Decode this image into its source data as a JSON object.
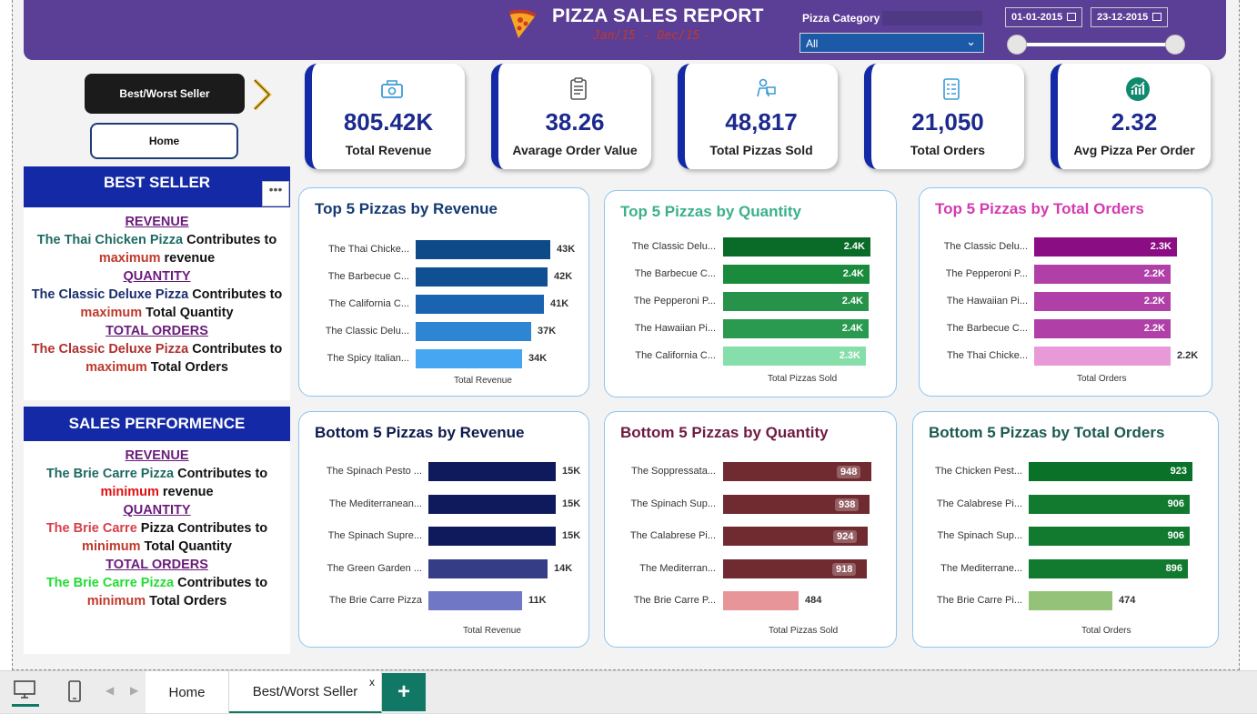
{
  "header": {
    "title": "PIZZA SALES REPORT",
    "subtitle": "Jan/15  -  Dec/15",
    "category_label": "Pizza Category",
    "category_value": "All",
    "date_start": "01-01-2015",
    "date_end": "23-12-2015"
  },
  "nav": {
    "best_worst": "Best/Worst Seller",
    "home": "Home"
  },
  "kpis": [
    {
      "value": "805.42K",
      "label": "Total Revenue",
      "icon": "money-icon"
    },
    {
      "value": "38.26",
      "label": "Avarage Order Value",
      "icon": "clipboard-icon"
    },
    {
      "value": "48,817",
      "label": "Total Pizzas Sold",
      "icon": "delivery-icon"
    },
    {
      "value": "21,050",
      "label": "Total Orders",
      "icon": "order-list-icon"
    },
    {
      "value": "2.32",
      "label": "Avg Pizza Per Order",
      "icon": "chart-icon"
    }
  ],
  "best_seller": {
    "title": "BEST SELLER",
    "revenue_h": "REVENUE",
    "revenue_name": "The Thai Chicken Pizza",
    "revenue_mid": " Contributes to",
    "revenue_kw": "maximum",
    "revenue_end": " revenue",
    "quantity_h": "QUANTITY",
    "quantity_name": "The Classic Deluxe Pizza",
    "quantity_mid": " Contributes to",
    "quantity_kw": "maximum",
    "quantity_end": " Total Quantity",
    "orders_h": "TOTAL ORDERS",
    "orders_name": "The Classic Deluxe Pizza",
    "orders_mid": " Contributes to",
    "orders_kw": "maximum",
    "orders_end": " Total Orders"
  },
  "sales_perf": {
    "title": "SALES PERFORMENCE",
    "revenue_h": "REVENUE",
    "revenue_name": "The Brie Carre Pizza",
    "revenue_mid": " Contributes to",
    "revenue_kw": "minimum",
    "revenue_end": " revenue",
    "quantity_h": "QUANTITY",
    "quantity_name": "The Brie Carre",
    "quantity_mid": " Pizza Contributes to",
    "quantity_kw": "minimum",
    "quantity_end": " Total Quantity",
    "orders_h": "TOTAL ORDERS",
    "orders_name": "The Brie Carre Pizza",
    "orders_mid": " Contributes to",
    "orders_kw": "minimum",
    "orders_end": " Total Orders"
  },
  "chart_data": [
    {
      "type": "bar",
      "title": "Top 5 Pizzas by Revenue",
      "xlabel": "Total Revenue",
      "categories": [
        "The Thai Chicke...",
        "The Barbecue C...",
        "The California C...",
        "The Classic Delu...",
        "The Spicy Italian..."
      ],
      "values": [
        43,
        42,
        41,
        37,
        34
      ],
      "labels": [
        "43K",
        "42K",
        "41K",
        "37K",
        "34K"
      ],
      "colors": [
        "#0d4a87",
        "#104f92",
        "#1a63b0",
        "#2d85d4",
        "#46a6f2"
      ],
      "label_inside": false
    },
    {
      "type": "bar",
      "title": "Top 5 Pizzas by Quantity",
      "xlabel": "Total Pizzas Sold",
      "categories": [
        "The Classic Delu...",
        "The Barbecue C...",
        "The Pepperoni P...",
        "The Hawaiian Pi...",
        "The California C..."
      ],
      "values": [
        2.45,
        2.43,
        2.42,
        2.42,
        2.37
      ],
      "labels": [
        "2.4K",
        "2.4K",
        "2.4K",
        "2.4K",
        "2.3K"
      ],
      "colors": [
        "#096b27",
        "#1a8a3c",
        "#27924a",
        "#2a9a50",
        "#86dfaa"
      ],
      "label_inside": true
    },
    {
      "type": "bar",
      "title": "Top 5 Pizzas by Total Orders",
      "xlabel": "Total Orders",
      "categories": [
        "The Classic Delu...",
        "The Pepperoni P...",
        "The Hawaiian Pi...",
        "The Barbecue C...",
        "The Thai Chicke..."
      ],
      "values": [
        2.3,
        2.2,
        2.2,
        2.2,
        2.2
      ],
      "labels": [
        "2.3K",
        "2.2K",
        "2.2K",
        "2.2K",
        "2.2K"
      ],
      "colors": [
        "#8b0d83",
        "#b040a8",
        "#b040a8",
        "#b040a8",
        "#e89ad8"
      ],
      "label_inside": true
    },
    {
      "type": "bar",
      "title": "Bottom 5 Pizzas by Revenue",
      "xlabel": "Total Revenue",
      "categories": [
        "The Spinach Pesto ...",
        "The Mediterranean...",
        "The Spinach Supre...",
        "The Green Garden ...",
        "The Brie Carre Pizza"
      ],
      "values": [
        15,
        15,
        15,
        14,
        11
      ],
      "labels": [
        "15K",
        "15K",
        "15K",
        "14K",
        "11K"
      ],
      "colors": [
        "#0e1a5c",
        "#0e1a5c",
        "#0e1a5c",
        "#343d86",
        "#7078c6"
      ],
      "label_inside": false
    },
    {
      "type": "bar",
      "title": "Bottom 5 Pizzas by Quantity",
      "xlabel": "Total Pizzas Sold",
      "categories": [
        "The Soppressata...",
        "The Spinach Sup...",
        "The Calabrese Pi...",
        "The Mediterran...",
        "The Brie Carre P..."
      ],
      "values": [
        948,
        938,
        924,
        918,
        484
      ],
      "labels": [
        "948",
        "938",
        "924",
        "918",
        "484"
      ],
      "colors": [
        "#702b30",
        "#702b30",
        "#702b30",
        "#702b30",
        "#e8959a"
      ],
      "label_inside": true
    },
    {
      "type": "bar",
      "title": "Bottom 5 Pizzas by Total Orders",
      "xlabel": "Total Orders",
      "categories": [
        "The Chicken Pest...",
        "The Calabrese Pi...",
        "The Spinach Sup...",
        "The Mediterrane...",
        "The Brie Carre Pi..."
      ],
      "values": [
        923,
        906,
        906,
        896,
        474
      ],
      "labels": [
        "923",
        "906",
        "906",
        "896",
        "474"
      ],
      "colors": [
        "#097228",
        "#117a2e",
        "#117a2e",
        "#117a2e",
        "#94c279"
      ],
      "label_inside": true
    }
  ],
  "tabs": {
    "home": "Home",
    "best_worst": "Best/Worst Seller",
    "close": "x",
    "add": "+"
  }
}
